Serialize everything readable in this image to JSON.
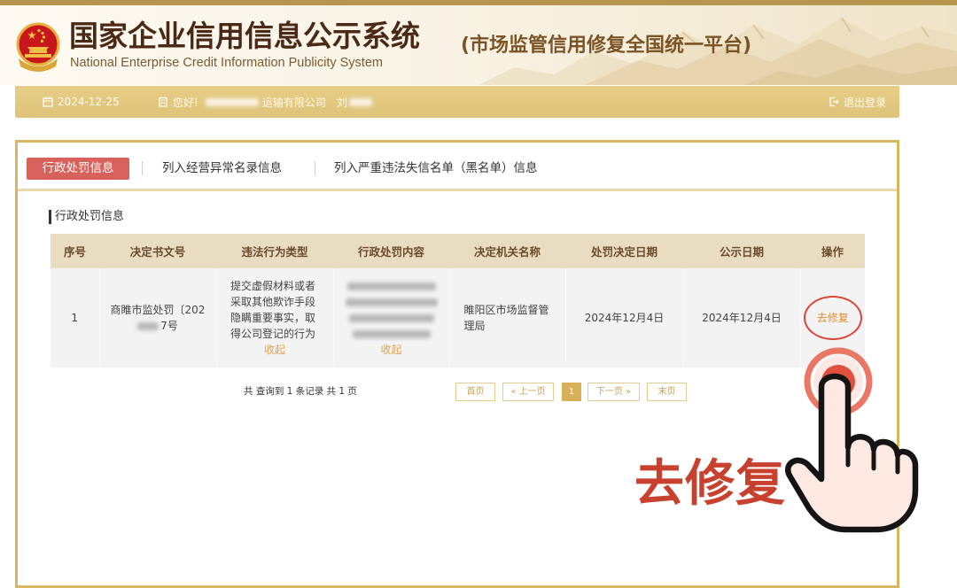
{
  "header": {
    "title": "国家企业信用信息公示系统",
    "title_en": "National Enterprise Credit Information Publicity System",
    "subtitle": "(市场监管信用修复全国统一平台)"
  },
  "user_bar": {
    "date": "2024-12-25",
    "greeting": "您好!",
    "company_visible": "运输有限公司",
    "user_visible": "刘",
    "logout_label": "退出登录"
  },
  "tabs": [
    {
      "label": "行政处罚信息",
      "selected": true
    },
    {
      "label": "列入经营异常名录信息",
      "selected": false
    },
    {
      "label": "列入严重违法失信名单（黑名单）信息",
      "selected": false
    }
  ],
  "section_title": "行政处罚信息",
  "table": {
    "columns": [
      "序号",
      "决定书文号",
      "违法行为类型",
      "行政处罚内容",
      "决定机关名称",
      "处罚决定日期",
      "公示日期",
      "操作"
    ],
    "rows": [
      {
        "index": "1",
        "decision_no_line1": "商睢市监处罚〔202",
        "decision_no_line2_visible": "7号",
        "violation_type": "提交虚假材料或者采取其他欺诈手段隐瞒重要事实，取得公司登记的行为",
        "violation_toggle": "收起",
        "penalty_content_toggle": "收起",
        "authority": "睢阳区市场监督管理局",
        "decision_date": "2024年12月4日",
        "publish_date": "2024年12月4日",
        "action": "去修复"
      }
    ]
  },
  "pagination": {
    "summary": "共 查询到 1 条记录 共 1 页",
    "first": "首页",
    "prev": "« 上一页",
    "current": "1",
    "next": "下一页 »",
    "last": "末页"
  },
  "callout": "去修复",
  "colors": {
    "top_strip": "#b8954f",
    "title_brown": "#4a2a17",
    "user_bar": "#e3c87e",
    "panel_border": "#d8b762",
    "active_tab": "#d9615b",
    "table_header": "#e8dcc1",
    "row_bg": "#f3f3f3",
    "link_orange": "#e3a24b",
    "action_ring": "#d9473a",
    "pager_active": "#d8b059",
    "callout_red": "#c8412f"
  },
  "icons": {
    "emblem": "national-emblem-icon",
    "date": "calendar-icon",
    "account": "building-icon",
    "logout": "logout-icon",
    "target": "tap-target-icon",
    "pointer": "hand-pointer-icon"
  }
}
